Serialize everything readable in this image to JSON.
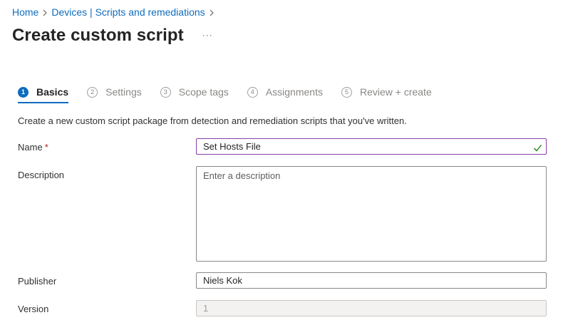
{
  "breadcrumb": {
    "items": [
      "Home",
      "Devices | Scripts and remediations"
    ]
  },
  "header": {
    "title": "Create custom script",
    "more_label": "···"
  },
  "steps": [
    {
      "number": "1",
      "label": "Basics",
      "active": true
    },
    {
      "number": "2",
      "label": "Settings",
      "active": false
    },
    {
      "number": "3",
      "label": "Scope tags",
      "active": false
    },
    {
      "number": "4",
      "label": "Assignments",
      "active": false
    },
    {
      "number": "5",
      "label": "Review + create",
      "active": false
    }
  ],
  "intro_text": "Create a new custom script package from detection and remediation scripts that you've written.",
  "form": {
    "name": {
      "label": "Name",
      "required_mark": "*",
      "value": "Set Hosts File"
    },
    "description": {
      "label": "Description",
      "placeholder": "Enter a description",
      "value": ""
    },
    "publisher": {
      "label": "Publisher",
      "value": "Niels Kok"
    },
    "version": {
      "label": "Version",
      "value": "1"
    }
  },
  "colors": {
    "link": "#0f6cbd",
    "accent": "#0f6cbd",
    "focus_border": "#8a3fa8",
    "valid_check": "#107c10",
    "required": "#a4262c"
  },
  "icons": {
    "breadcrumb_separator": "chevron-right-icon",
    "valid": "checkmark-icon"
  }
}
